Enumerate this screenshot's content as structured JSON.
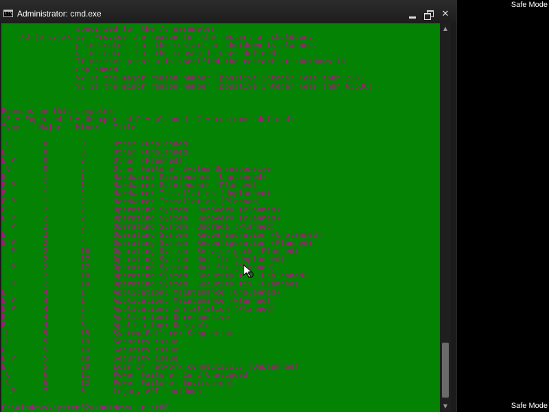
{
  "desktop": {
    "safe_mode_top": "Safe Mode",
    "safe_mode_bottom": "Safe Mode"
  },
  "window": {
    "title": "Administrator: cmd.exe",
    "icon_text": "C:\\",
    "controls": {
      "minimize": "minimize-icon",
      "maximize": "restore-icon",
      "close": "✕"
    }
  },
  "colors": {
    "console_background": "#048204",
    "console_text": "#a8147c",
    "titlebar": "#1d1d1d"
  },
  "console": {
    "lines": [
      "                specified for the /c parameter.",
      "    /d [p|u:]xx:yy  Provide the reason for the restart or shutdown.",
      "                p indicates that the restart or shutdown is planned.",
      "                u indicates that the reason is user defined.",
      "                If neither p nor u is specified the restart or shutdown is",
      "                unplanned.",
      "                xx is the major reason number (positive integer less than 256).",
      "                yy is the minor reason number (positive integer less than 65536).",
      "",
      "",
      "Reasons on this computer:",
      "(E = Expected U = Unexpected P = planned, C = customer defined)",
      "Type    Major   Minor   Title",
      "",
      " U       0       0      Other (Unplanned)",
      "E        0       0      Other (Unplanned)",
      "E P      0       0      Other (Planned)",
      " U       0       5      Other Failure: System Unresponsive",
      "E        1       1      Hardware: Maintenance (Unplanned)",
      "E P      1       1      Hardware: Maintenance (Planned)",
      "E        1       2      Hardware: Installation (Unplanned)",
      "E P      1       2      Hardware: Installation (Planned)",
      "E        2       2      Operating System: Recovery (Planned)",
      "E P      2       2      Operating System: Recovery (Planned)",
      "  P      2       3      Operating System: Upgrade (Planned)",
      "E        2       4      Operating System: Reconfiguration (Unplanned)",
      "E P      2       4      Operating System: Reconfiguration (Planned)",
      "  P      2       16     Operating System: Service pack (Planned)",
      "         2       17     Operating System: Hot fix (Unplanned)",
      "  P      2       17     Operating System: Hot fix (Planned)",
      "         2       18     Operating System: Security fix (Unplanned)",
      "  P      2       18     Operating System: Security fix (Planned)",
      "E        4       1      Application: Maintenance (Unplanned)",
      "E P      4       1      Application: Maintenance (Planned)",
      "E P      4       2      Application: Installation (Planned)",
      "E        4       5      Application: Unresponsive",
      "E        4       6      Application: Unstable",
      " U       5       15     System Failure: Stop error",
      " U       5       19     Security issue",
      "E        5       19     Security issue",
      "E P      5       19     Security issue",
      "E        5       20     Loss of network connectivity (Unplanned)",
      " U       6       11     Power Failure: Cord Unplugged",
      " U       6       12     Power Failure: Environment",
      "  P      7       0      Legacy API shutdown",
      "",
      "C:\\Windows\\system32>shutdown -r /t00"
    ]
  }
}
